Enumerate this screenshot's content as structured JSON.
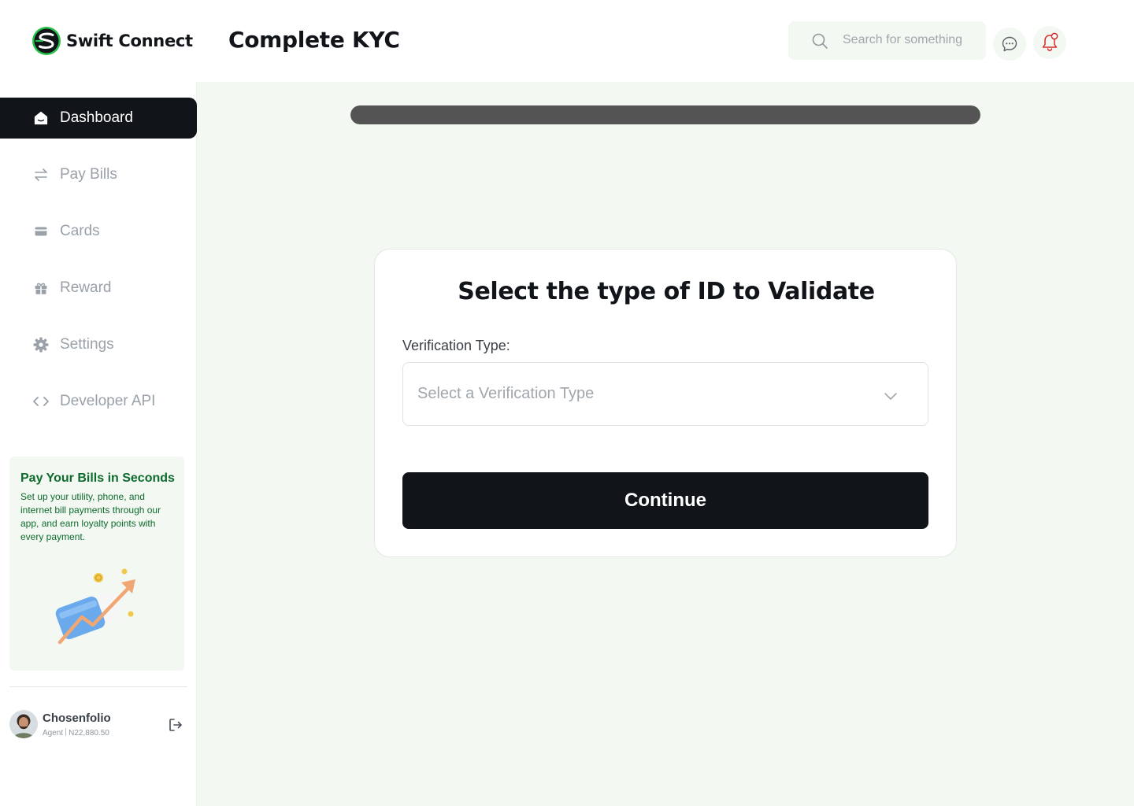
{
  "brand": {
    "name": "Swift Connect",
    "accent": "#0d6b2c",
    "dark": "#111418",
    "logo_green": "#27c24c"
  },
  "header": {
    "title": "Complete KYC",
    "search": {
      "placeholder": "Search for something",
      "value": ""
    },
    "icons": [
      "search-icon",
      "chat-icon",
      "bell-icon"
    ]
  },
  "sidebar": {
    "items": [
      {
        "label": "Dashboard",
        "icon": "home-icon",
        "active": true
      },
      {
        "label": "Pay Bills",
        "icon": "transfer-arrows-icon",
        "active": false
      },
      {
        "label": "Cards",
        "icon": "card-icon",
        "active": false
      },
      {
        "label": "Reward",
        "icon": "gift-icon",
        "active": false
      },
      {
        "label": "Settings",
        "icon": "gear-icon",
        "active": false
      },
      {
        "label": "Developer API",
        "icon": "code-icon",
        "active": false
      }
    ],
    "promo": {
      "title": "Pay Your Bills in Seconds",
      "text": "Set up your utility, phone, and internet bill payments through our app, and earn loyalty points with every payment."
    },
    "user": {
      "name": "Chosenfolio",
      "role": "Agent",
      "balance": "N22,880.50"
    }
  },
  "kyc": {
    "progress": 1.0,
    "title": "Select the type of ID to Validate",
    "field_label": "Verification Type:",
    "select_placeholder": "Select a Verification Type",
    "continue_label": "Continue"
  }
}
